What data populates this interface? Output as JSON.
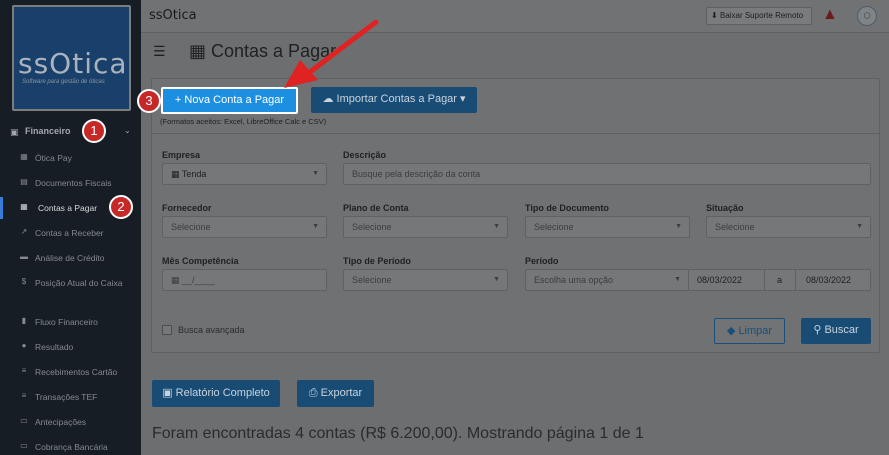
{
  "sidebar": {
    "logo_text": "ssOtica",
    "logo_subtitle": "Software para gestão de óticas",
    "section_label": "Financeiro",
    "items": [
      {
        "label": "Ótica Pay",
        "icon": "building-icon"
      },
      {
        "label": "Documentos Fiscais",
        "icon": "document-icon"
      },
      {
        "label": "Contas a Pagar",
        "icon": "calculator-icon"
      },
      {
        "label": "Contas a Receber",
        "icon": "chart-line-icon"
      },
      {
        "label": "Análise de Crédito",
        "icon": "id-card-icon"
      },
      {
        "label": "Posição Atual do Caixa",
        "icon": "dollar-icon"
      },
      {
        "label": "Fluxo Financeiro",
        "icon": "bar-chart-icon"
      },
      {
        "label": "Resultado",
        "icon": "pie-chart-icon"
      },
      {
        "label": "Recebimentos Cartão",
        "icon": "list-icon"
      },
      {
        "label": "Transações TEF",
        "icon": "list-icon"
      },
      {
        "label": "Antecipações",
        "icon": "card-icon"
      },
      {
        "label": "Cobrança Bancária",
        "icon": "card-icon"
      }
    ]
  },
  "topbar": {
    "brand": "ssOtica",
    "support_label": "Baixar Suporte Remoto"
  },
  "header": {
    "title": "Contas a Pagar"
  },
  "actions": {
    "new_label": "Nova Conta a Pagar",
    "import_label": "Importar Contas a Pagar",
    "formats_note": "(Formatos aceitos: Excel, LibreOffice Calc e CSV)"
  },
  "filters": {
    "empresa": {
      "label": "Empresa",
      "value": "Tenda"
    },
    "descricao": {
      "label": "Descrição",
      "placeholder": "Busque pela descrição da conta"
    },
    "fornecedor": {
      "label": "Fornecedor",
      "value": "Selecione"
    },
    "plano_conta": {
      "label": "Plano de Conta",
      "value": "Selecione"
    },
    "tipo_documento": {
      "label": "Tipo de Documento",
      "value": "Selecione"
    },
    "situacao": {
      "label": "Situação",
      "value": "Selecione"
    },
    "mes_competencia": {
      "label": "Mês Competência",
      "value": "__/____"
    },
    "tipo_periodo": {
      "label": "Tipo de Período",
      "value": "Selecione"
    },
    "periodo": {
      "label": "Período",
      "value": "Escolha uma opção",
      "from": "08/03/2022",
      "sep": "a",
      "to": "08/03/2022"
    },
    "advanced_label": "Busca avançada",
    "clear_label": "Limpar",
    "search_label": "Buscar"
  },
  "reports": {
    "full_report_label": "Relatório Completo",
    "export_label": "Exportar"
  },
  "results": {
    "summary": "Foram encontradas 4 contas (R$ 6.200,00). Mostrando página 1 de 1"
  },
  "annotations": {
    "step1": "1",
    "step2": "2",
    "step3": "3"
  },
  "colors": {
    "sidebar_bg": "#161d24",
    "primary": "#184c75",
    "highlight": "#1d8fe0",
    "badge": "#c62828"
  }
}
